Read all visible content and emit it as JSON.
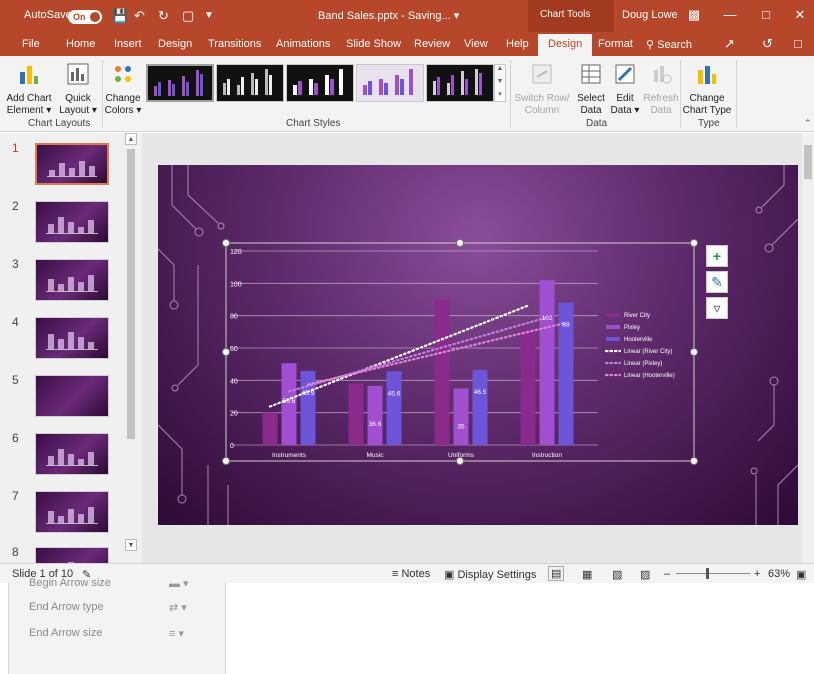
{
  "titlebar": {
    "autosave_label": "AutoSave",
    "autosave_state": "On",
    "doc_title": "Band Sales.pptx - Saving... ▾",
    "context_tab": "Chart Tools",
    "user_name": "Doug Lowe"
  },
  "tabs": [
    "File",
    "Home",
    "Insert",
    "Design",
    "Transitions",
    "Animations",
    "Slide Show",
    "Review",
    "View",
    "Help",
    "Design",
    "Format"
  ],
  "active_tab": "Design",
  "search_label": "Search",
  "ribbon": {
    "add_chart_element": [
      "Add Chart",
      "Element ▾"
    ],
    "quick_layout": [
      "Quick",
      "Layout ▾"
    ],
    "change_colors": [
      "Change",
      "Colors ▾"
    ],
    "switch_row_col": [
      "Switch Row/",
      "Column"
    ],
    "select_data": [
      "Select",
      "Data"
    ],
    "edit_data": [
      "Edit",
      "Data ▾"
    ],
    "refresh_data": [
      "Refresh",
      "Data"
    ],
    "change_chart_type": [
      "Change",
      "Chart Type"
    ],
    "groups": [
      "Chart Layouts",
      "Chart Styles",
      "Data",
      "Type"
    ]
  },
  "thumbnails": [
    "1",
    "2",
    "3",
    "4",
    "5",
    "6",
    "7",
    "8"
  ],
  "selected_slide": "1",
  "chart_data": {
    "type": "bar",
    "categories": [
      "Instruments",
      "Music",
      "Uniforms",
      "Instruction"
    ],
    "series": [
      {
        "name": "River City",
        "values": [
          20,
          38,
          90,
          72
        ],
        "color": "#8a2a8a"
      },
      {
        "name": "Pixley",
        "values": [
          50.6,
          36.6,
          35,
          102
        ],
        "color": "#a04fd0"
      },
      {
        "name": "Hooterville",
        "values": [
          45.9,
          45.6,
          46.5,
          88
        ],
        "color": "#6c55d8"
      }
    ],
    "trendlines": [
      {
        "name": "Linear (River City)",
        "color": "#ffffff"
      },
      {
        "name": "Linear (Pixley)",
        "color": "#c77ce0"
      },
      {
        "name": "Linear (Hooterville)",
        "color": "#e084d8"
      }
    ],
    "data_labels": [
      "50.6",
      "45.9",
      "36.6",
      "45.6",
      "35",
      "46.5",
      "102",
      "88"
    ],
    "y_ticks": [
      "0",
      "20",
      "40",
      "60",
      "80",
      "100",
      "120"
    ],
    "ylim": [
      0,
      120
    ],
    "legend_position": "right",
    "grid": true
  },
  "chart_buttons": [
    "chart-elements",
    "chart-styles",
    "chart-filters"
  ],
  "status": {
    "slide_info": "Slide 1 of 10",
    "notes": "Notes",
    "display_settings": "Display Settings",
    "zoom": "63%"
  },
  "lower_panel": {
    "items": [
      "Begin Arrow size",
      "End Arrow type",
      "End Arrow size"
    ]
  },
  "colors": {
    "accent": "#b7472a",
    "slide_bg": "#5e2a6b"
  }
}
